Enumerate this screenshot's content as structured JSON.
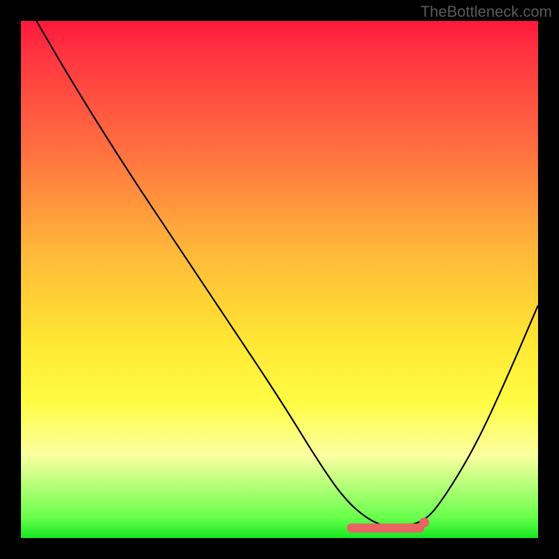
{
  "attribution": "TheBottleneck.com",
  "chart_data": {
    "type": "line",
    "title": "",
    "xlabel": "",
    "ylabel": "",
    "xlim": [
      0,
      100
    ],
    "ylim": [
      0,
      100
    ],
    "series": [
      {
        "name": "bottleneck-curve",
        "x": [
          3,
          10,
          20,
          30,
          40,
          50,
          58,
          63,
          68,
          72,
          78,
          82,
          88,
          94,
          100
        ],
        "y": [
          100,
          88,
          72,
          57,
          42,
          27,
          14,
          7,
          3,
          2,
          3,
          8,
          18,
          31,
          45
        ]
      }
    ],
    "optimal_range": {
      "x_start": 63,
      "x_end": 78,
      "y": 2
    },
    "marker": {
      "x": 78,
      "y": 3
    },
    "background_gradient_stops": [
      {
        "pos": 0,
        "color": "#ff183d"
      },
      {
        "pos": 25,
        "color": "#ff7040"
      },
      {
        "pos": 62,
        "color": "#ffe733"
      },
      {
        "pos": 84,
        "color": "#fbffa0"
      },
      {
        "pos": 100,
        "color": "#16e820"
      }
    ]
  }
}
